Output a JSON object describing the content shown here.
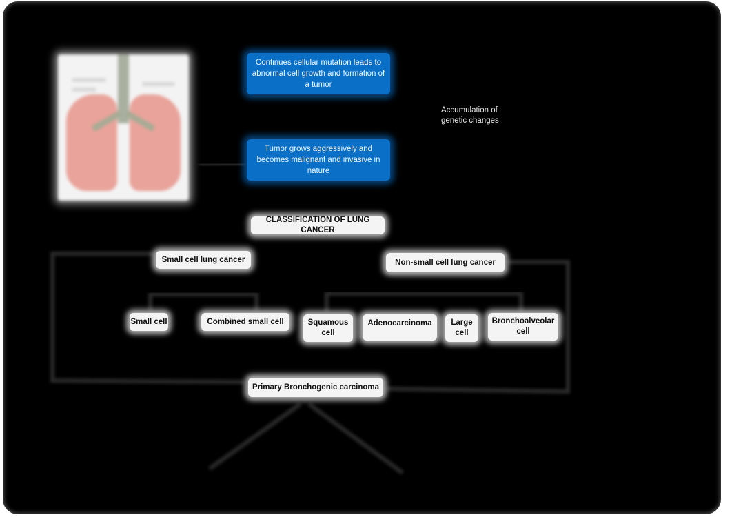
{
  "diagram": {
    "title": "CLASSIFICATION OF LUNG CANCER",
    "illustration": {
      "name": "lungs-anatomy-illustration"
    },
    "flow": {
      "step1": "Continues cellular mutation leads to abnormal cell growth and formation of a tumor",
      "side_note": "Accumulation of genetic changes",
      "step2": "Tumor grows aggressively and becomes malignant and invasive in nature"
    },
    "classification": {
      "heading": "CLASSIFICATION OF LUNG CANCER",
      "small_cell": {
        "label": "Small cell lung cancer",
        "subtypes": [
          "Small cell",
          "Combined small cell"
        ]
      },
      "non_small_cell": {
        "label": "Non-small cell lung cancer",
        "subtypes": [
          "Squamous cell",
          "Adenocarcinoma",
          "Large cell",
          "Bronchoalveolar cell"
        ]
      }
    },
    "outcome": "Primary Bronchogenic carcinoma"
  },
  "colors": {
    "background": "#000000",
    "blue_box": "#0a6fc7",
    "white_box": "#f4f4f4"
  }
}
